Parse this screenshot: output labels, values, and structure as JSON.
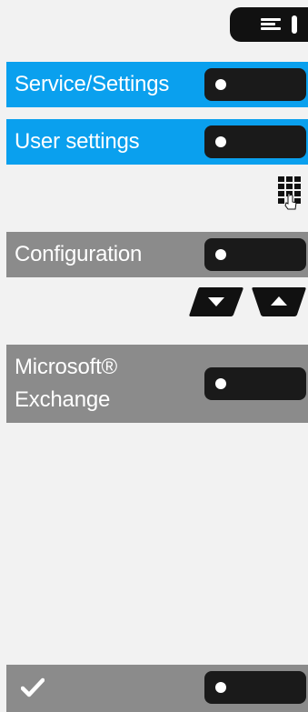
{
  "menu": {
    "icon": "menu-icon"
  },
  "rows": [
    {
      "label": "Service/Settings",
      "color": "#0aa0ee"
    },
    {
      "label": "User settings",
      "color": "#0aa0ee"
    },
    {
      "label": "Configuration",
      "color": "#8b8b8b"
    },
    {
      "label": "Microsoft®\nExchange",
      "color": "#8b8b8b"
    }
  ],
  "confirm": {
    "icon": "checkmark-icon",
    "color": "#8b8b8b"
  },
  "icons": {
    "keypad": "keypad-icon",
    "nav_down": "arrow-down-icon",
    "nav_up": "arrow-up-icon"
  }
}
